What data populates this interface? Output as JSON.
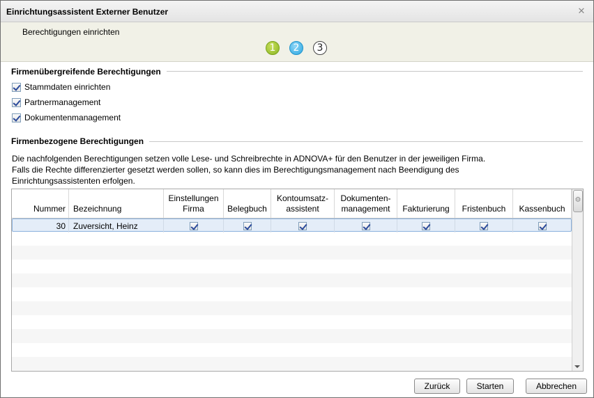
{
  "window": {
    "title": "Einrichtungsassistent Externer Benutzer",
    "close_glyph": "✕"
  },
  "header": {
    "subtitle": "Berechtigungen einrichten",
    "steps": [
      {
        "label": "1",
        "state": "done"
      },
      {
        "label": "2",
        "state": "active"
      },
      {
        "label": "3",
        "state": "todo"
      }
    ]
  },
  "global_permissions": {
    "title": "Firmenübergreifende Berechtigungen",
    "items": [
      {
        "label": "Stammdaten einrichten",
        "checked": true
      },
      {
        "label": "Partnermanagement",
        "checked": true
      },
      {
        "label": "Dokumentenmanagement",
        "checked": true
      }
    ]
  },
  "company_permissions": {
    "title": "Firmenbezogene Berechtigungen",
    "description_lines": [
      "Die nachfolgenden Berechtigungen setzen volle Lese- und Schreibrechte in ADNOVA+ für den Benutzer in der jeweiligen Firma.",
      "Falls die Rechte differenzierter gesetzt werden sollen, so kann dies im Berechtigungsmanagement nach Beendigung des",
      "Einrichtungsassistenten erfolgen."
    ],
    "table": {
      "columns": [
        {
          "label": "Nummer"
        },
        {
          "label": "Bezeichnung"
        },
        {
          "label": "Einstellungen\nFirma"
        },
        {
          "label": "Belegbuch"
        },
        {
          "label": "Kontoumsatz-\nassistent"
        },
        {
          "label": "Dokumenten-\nmanagement"
        },
        {
          "label": "Fakturierung"
        },
        {
          "label": "Fristenbuch"
        },
        {
          "label": "Kassenbuch"
        }
      ],
      "rows": [
        {
          "nummer": "30",
          "bezeichnung": "Zuversicht, Heinz",
          "selected": true,
          "checks": [
            true,
            true,
            true,
            true,
            true,
            true,
            true
          ]
        }
      ]
    }
  },
  "buttons": {
    "back": "Zurück",
    "start": "Starten",
    "cancel": "Abbrechen"
  },
  "icons": {
    "close": "close-icon",
    "settings": "gear-icon",
    "scroll_down": "arrow-down-icon"
  },
  "colors": {
    "header_bg": "#f1f1e7",
    "step_done": "#8ab523",
    "step_active": "#2aa6e0",
    "selection": "#e4edf8"
  }
}
